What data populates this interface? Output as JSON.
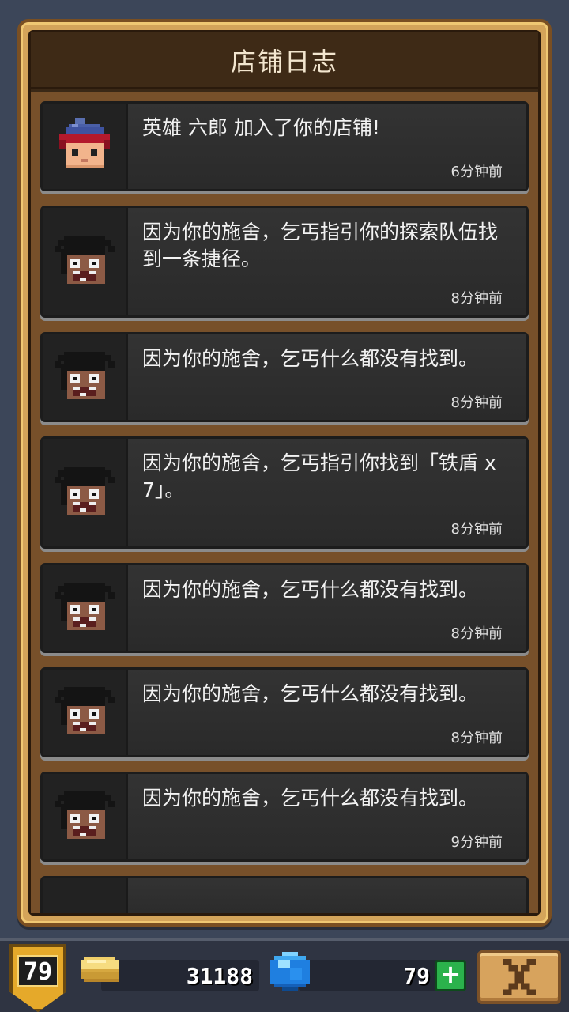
{
  "title": "店铺日志",
  "entries": [
    {
      "text": "英雄 六郎 加入了你的店铺!",
      "time": "6分钟前",
      "avatar": "hero-rokuro"
    },
    {
      "text": "因为你的施舍，乞丐指引你的探索队伍找到一条捷径。",
      "time": "8分钟前",
      "avatar": "beggar"
    },
    {
      "text": "因为你的施舍，乞丐什么都没有找到。",
      "time": "8分钟前",
      "avatar": "beggar"
    },
    {
      "text": "因为你的施舍，乞丐指引你找到「铁盾 x 7」。",
      "time": "8分钟前",
      "avatar": "beggar"
    },
    {
      "text": "因为你的施舍，乞丐什么都没有找到。",
      "time": "8分钟前",
      "avatar": "beggar"
    },
    {
      "text": "因为你的施舍，乞丐什么都没有找到。",
      "time": "8分钟前",
      "avatar": "beggar"
    },
    {
      "text": "因为你的施舍，乞丐什么都没有找到。",
      "time": "9分钟前",
      "avatar": "beggar"
    }
  ],
  "hud": {
    "level": "79",
    "gold": "31188",
    "gems": "79",
    "plus_label": "+",
    "coin_icon": "gold-coins-icon",
    "gem_icon": "blue-gem-icon",
    "close_icon": "close-x-icon"
  },
  "colors": {
    "panel_gold": "#d4a45a",
    "list_brown": "#77502a",
    "entry_dark": "#2b2b2b",
    "plus_green": "#2bb24c"
  }
}
